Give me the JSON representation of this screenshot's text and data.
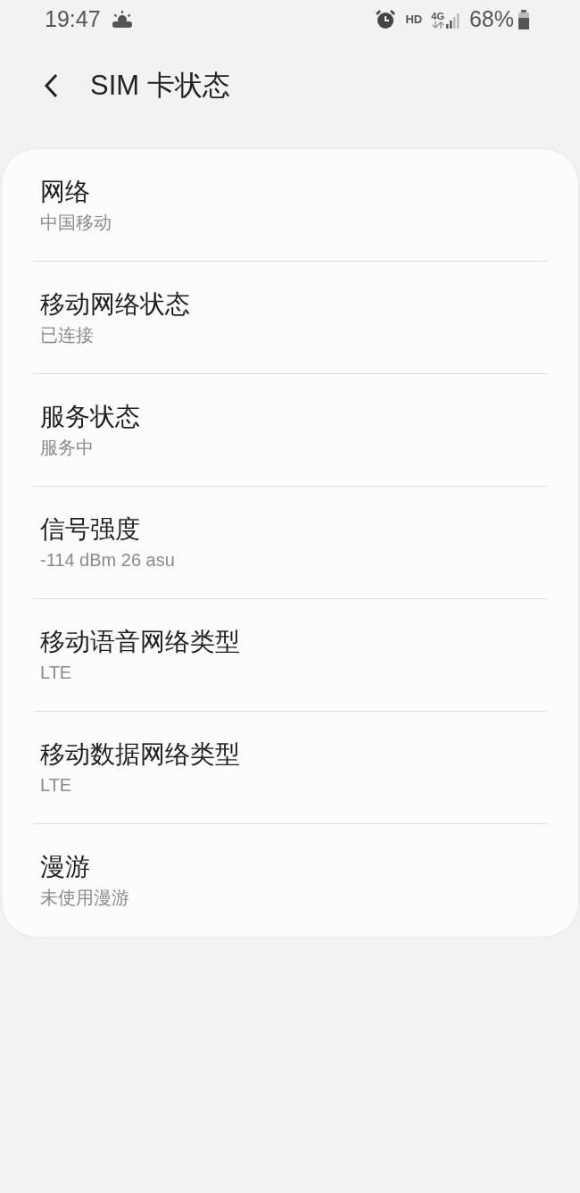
{
  "status_bar": {
    "time": "19:47",
    "network_label": "HD",
    "data_label": "4G",
    "battery": "68%"
  },
  "header": {
    "title": "SIM 卡状态"
  },
  "items": [
    {
      "title": "网络",
      "value": "中国移动"
    },
    {
      "title": "移动网络状态",
      "value": "已连接"
    },
    {
      "title": "服务状态",
      "value": "服务中"
    },
    {
      "title": "信号强度",
      "value": "-114 dBm 26 asu"
    },
    {
      "title": "移动语音网络类型",
      "value": "LTE"
    },
    {
      "title": "移动数据网络类型",
      "value": "LTE"
    },
    {
      "title": "漫游",
      "value": "未使用漫游"
    }
  ]
}
